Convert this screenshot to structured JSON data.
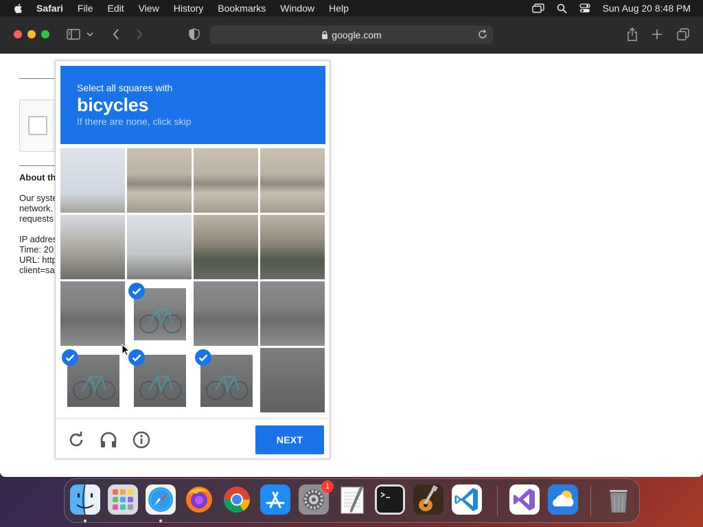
{
  "menubar": {
    "app_name": "Safari",
    "menus": [
      "File",
      "Edit",
      "View",
      "History",
      "Bookmarks",
      "Window",
      "Help"
    ],
    "clock": "Sun Aug 20  8:48 PM"
  },
  "browser": {
    "url": "google.com"
  },
  "page": {
    "heading_partial": "About th",
    "paragraph1": [
      "Our syste",
      "network.",
      "requests"
    ],
    "paragraph2": [
      "IP addres",
      "Time: 20",
      "URL: http",
      "client=sa"
    ]
  },
  "captcha": {
    "instruction": "Select all squares with",
    "target": "bicycles",
    "hint": "If there are none, click skip",
    "next_label": "NEXT",
    "grid_size": 4,
    "selected_tiles": [
      9,
      12,
      13,
      14
    ],
    "accent_color": "#1a73e8"
  },
  "dock": {
    "apps": [
      "Finder",
      "Launchpad",
      "Safari",
      "Firefox",
      "Chrome",
      "App Store",
      "System Settings",
      "TextEdit",
      "Terminal",
      "GarageBand",
      "Visual Studio Code",
      "Visual Studio",
      "Weather",
      "Trash"
    ],
    "settings_badge": "1"
  }
}
